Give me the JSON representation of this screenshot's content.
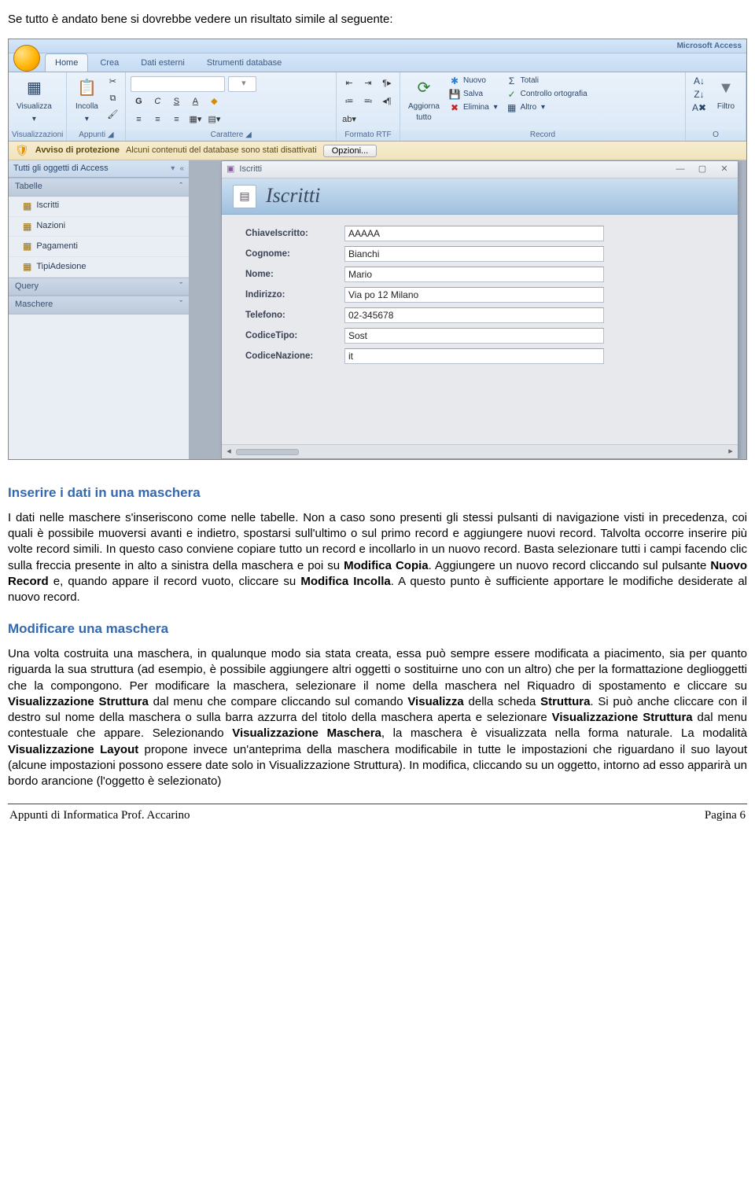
{
  "intro_text": "Se tutto è andato bene si dovrebbe vedere un risultato simile al seguente:",
  "branding": "Microsoft Access",
  "ribbon_tabs": [
    "Home",
    "Crea",
    "Dati esterni",
    "Strumenti database"
  ],
  "ribbon_tabs_active": 0,
  "ribbon_groups": {
    "visualizzazioni": {
      "label": "Visualizzazioni",
      "btn": "Visualizza"
    },
    "appunti": {
      "label": "Appunti",
      "btn": "Incolla"
    },
    "carattere": {
      "label": "Carattere"
    },
    "formatortf": {
      "label": "Formato RTF"
    },
    "record": {
      "label": "Record",
      "aggiorna": "Aggiorna\ntutto",
      "nuovo": "Nuovo",
      "salva": "Salva",
      "elimina": "Elimina",
      "totali": "Totali",
      "ortografia": "Controllo ortografia",
      "altro": "Altro"
    },
    "filtro": {
      "btn": "Filtro"
    }
  },
  "security_bar": {
    "title": "Avviso di protezione",
    "message": "Alcuni contenuti del database sono stati disattivati",
    "button": "Opzioni..."
  },
  "navpane": {
    "title": "Tutti gli oggetti di Access",
    "groups": [
      {
        "name": "Tabelle",
        "items": [
          "Iscritti",
          "Nazioni",
          "Pagamenti",
          "TipiAdesione"
        ]
      },
      {
        "name": "Query",
        "items": []
      },
      {
        "name": "Maschere",
        "items": []
      }
    ]
  },
  "form": {
    "tab_label": "Iscritti",
    "title": "Iscritti",
    "fields": [
      {
        "label": "ChiaveIscritto:",
        "value": "AAAAA"
      },
      {
        "label": "Cognome:",
        "value": "Bianchi"
      },
      {
        "label": "Nome:",
        "value": "Mario"
      },
      {
        "label": "Indirizzo:",
        "value": "Via po 12 Milano"
      },
      {
        "label": "Telefono:",
        "value": "02-345678"
      },
      {
        "label": "CodiceTipo:",
        "value": "Sost"
      },
      {
        "label": "CodiceNazione:",
        "value": "it"
      }
    ]
  },
  "sections": {
    "s1_title": "Inserire i dati in una maschera",
    "p1": "I dati nelle maschere s'inseriscono come nelle tabelle. Non a caso sono presenti gli stessi pulsanti di navigazione visti in precedenza, coi quali è possibile muoversi avanti e indietro, spostarsi sull'ultimo o sul primo record e aggiungere nuovi record. Talvolta occorre inserire più volte record simili. In questo caso conviene copiare tutto un record e incollarlo in un nuovo record. Basta selezionare tutti i campi facendo clic sulla freccia presente in alto a sinistra della maschera e poi su ",
    "p1b": "Modifica Copia",
    "p1c": ". Aggiungere un nuovo record cliccando sul pulsante ",
    "p1d": "Nuovo Record",
    "p1e": " e, quando appare il record vuoto, cliccare su ",
    "p1f": "Modifica Incolla",
    "p1g": ". A questo punto è sufficiente apportare le modifiche desiderate al nuovo record.",
    "s2_title": "Modificare una maschera",
    "p2": "Una volta costruita una maschera, in qualunque modo sia stata creata, essa può sempre essere modificata a piacimento, sia per quanto riguarda la sua struttura (ad esempio, è possibile aggiungere altri oggetti o sostituirne uno con un altro) che per la formattazione deglioggetti che la compongono. Per modificare la maschera, selezionare il nome della maschera nel Riquadro di spostamento e cliccare su ",
    "p2b": "Visualizzazione Struttura",
    "p2c": " dal menu che compare cliccando sul comando ",
    "p2d": "Visualizza",
    "p2e": " della scheda ",
    "p2f": "Struttura",
    "p2g": ". Si può anche cliccare con il destro sul nome della maschera o sulla barra azzurra del titolo della maschera aperta e selezionare ",
    "p2h": "Visualizzazione Struttura",
    "p2i": " dal menu contestuale che appare. Selezionando ",
    "p2j": "Visualizzazione Maschera",
    "p2k": ", la maschera è visualizzata nella forma naturale. La modalità ",
    "p2l": "Visualizzazione Layout",
    "p2m": " propone invece un'anteprima della maschera modificabile in tutte le impostazioni che riguardano il suo layout (alcune impostazioni possono essere date solo in Visualizzazione Struttura). In modifica, cliccando su un oggetto, intorno ad esso apparirà un bordo arancione (l'oggetto è selezionato)"
  },
  "footer": {
    "left": "Appunti di Informatica Prof. Accarino",
    "right": "Pagina 6"
  }
}
